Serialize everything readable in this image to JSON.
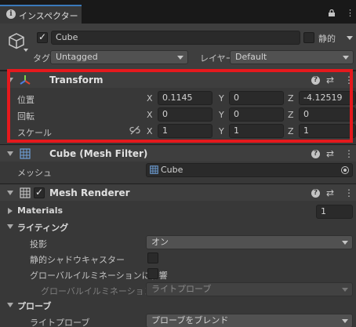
{
  "tab": {
    "icon": "info-icon",
    "label": "インスペクター",
    "lock_icon": "lock-icon",
    "menu_icon": "⋮"
  },
  "object": {
    "icon": "cube-icon",
    "active": true,
    "name": "Cube",
    "static_label": "静的",
    "static_checked": false,
    "tag_label": "タグ",
    "tag_value": "Untagged",
    "layer_label": "レイヤー",
    "layer_value": "Default"
  },
  "transform": {
    "title": "Transform",
    "icon": "transform-axes-icon",
    "rows": [
      {
        "label": "位置",
        "x": "0.1145",
        "y": "0",
        "z": "-4.12519"
      },
      {
        "label": "回転",
        "x": "0",
        "y": "0",
        "z": "0"
      },
      {
        "label": "スケール",
        "x": "1",
        "y": "1",
        "z": "1"
      }
    ],
    "axes": [
      "X",
      "Y",
      "Z"
    ]
  },
  "mesh_filter": {
    "title": "Cube (Mesh Filter)",
    "mesh_label": "メッシュ",
    "mesh_value": "Cube"
  },
  "mesh_renderer": {
    "title": "Mesh Renderer",
    "enabled": true,
    "materials_label": "Materials",
    "materials_count": "1",
    "lighting_label": "ライティング",
    "cast_shadows_label": "投影",
    "cast_shadows_value": "オン",
    "static_shadow_label": "静的シャドウキャスター",
    "gi_label": "グローバルイルミネーションに影響",
    "gi_receive_label": "グローバルイルミネーションを受",
    "gi_receive_value": "ライトプローブ",
    "probes_label": "プローブ",
    "light_probes_label": "ライトプローブ",
    "light_probes_value": "プローブをブレンド"
  },
  "colors": {
    "highlight": "#e5191d",
    "accent": "#3a79bb"
  }
}
